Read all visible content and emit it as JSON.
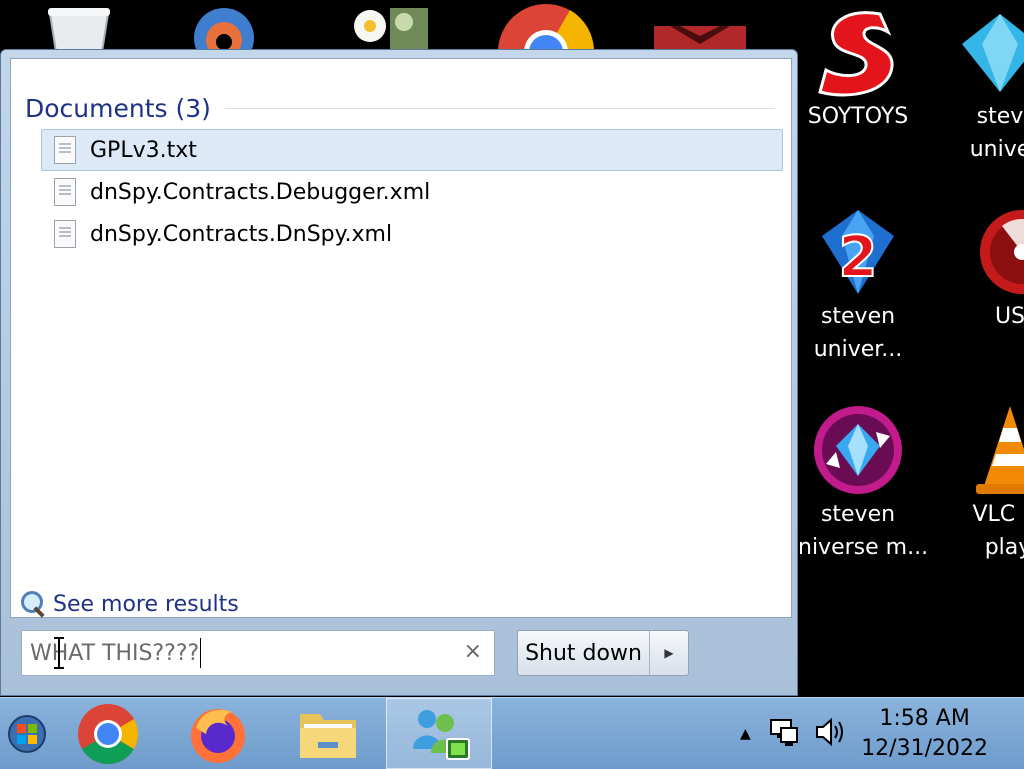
{
  "desktop": {
    "icons": [
      {
        "name": "SOYTOYS",
        "label": "SOYTOYS"
      },
      {
        "name": "steven-universe-1",
        "label": "stev\nunive"
      },
      {
        "name": "steven-universe-2",
        "label": "steven\nuniver..."
      },
      {
        "name": "us",
        "label": "US"
      },
      {
        "name": "steven-universe-m",
        "label": "steven\nniverse m..."
      },
      {
        "name": "vlc",
        "label": "VLC m\nplay"
      }
    ]
  },
  "start_menu": {
    "group_title": "Documents (3)",
    "results": [
      {
        "label": "GPLv3.txt",
        "selected": true
      },
      {
        "label": "dnSpy.Contracts.Debugger.xml",
        "selected": false
      },
      {
        "label": "dnSpy.Contracts.DnSpy.xml",
        "selected": false
      }
    ],
    "see_more": "See more results",
    "search": {
      "value": "WHAT THIS????",
      "clear": "×"
    },
    "shutdown": {
      "label": "Shut down",
      "arrow": "▶"
    }
  },
  "taskbar": {
    "clock_time": "1:58 AM",
    "clock_date": "12/31/2022"
  },
  "colors": {
    "accent_text": "#1e3287",
    "taskbar": "#7ea8d4",
    "selection": "#dde9f7"
  }
}
